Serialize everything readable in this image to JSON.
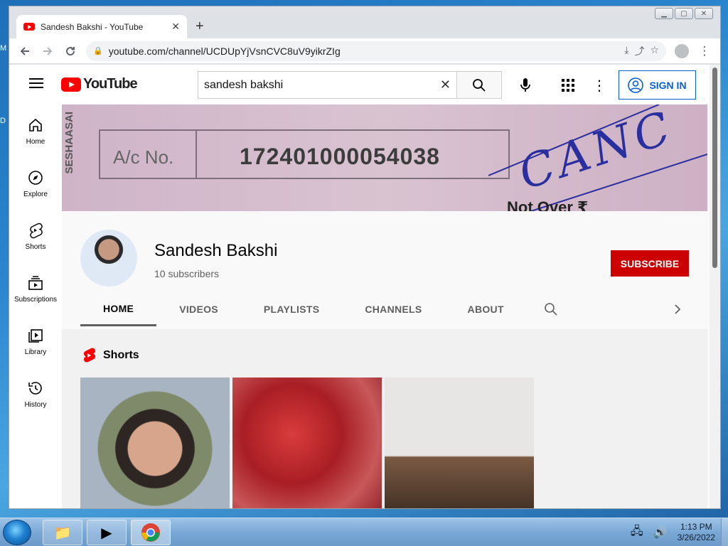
{
  "browser": {
    "tab_title": "Sandesh Bakshi - YouTube",
    "url": "youtube.com/channel/UCDUpYjVsnCVC8uV9yikrZIg"
  },
  "youtube": {
    "logo_text": "YouTube",
    "search_value": "sandesh bakshi",
    "sign_in_label": "SIGN IN"
  },
  "sidebar": {
    "items": [
      {
        "label": "Home",
        "icon": "home-icon"
      },
      {
        "label": "Explore",
        "icon": "compass-icon"
      },
      {
        "label": "Shorts",
        "icon": "shorts-icon"
      },
      {
        "label": "Subscriptions",
        "icon": "subscriptions-icon"
      },
      {
        "label": "Library",
        "icon": "library-icon"
      },
      {
        "label": "History",
        "icon": "history-icon"
      }
    ]
  },
  "banner": {
    "side_text": "SESHAASAI",
    "ac_label": "A/c No.",
    "account_number": "172401000054038",
    "handwriting": "CANC",
    "bottom_text": "Not Over ₹"
  },
  "channel": {
    "name": "Sandesh Bakshi",
    "subscribers": "10 subscribers",
    "subscribe_label": "SUBSCRIBE",
    "tabs": [
      "HOME",
      "VIDEOS",
      "PLAYLISTS",
      "CHANNELS",
      "ABOUT"
    ],
    "active_tab": "HOME"
  },
  "content": {
    "section_title": "Shorts"
  },
  "taskbar": {
    "time": "1:13 PM",
    "date": "3/26/2022"
  },
  "desktop": {
    "frag_m": "M",
    "frag_d": "D"
  },
  "colors": {
    "yt_red": "#ff0000",
    "subscribe_red": "#cc0000",
    "signin_blue": "#065fd4"
  }
}
